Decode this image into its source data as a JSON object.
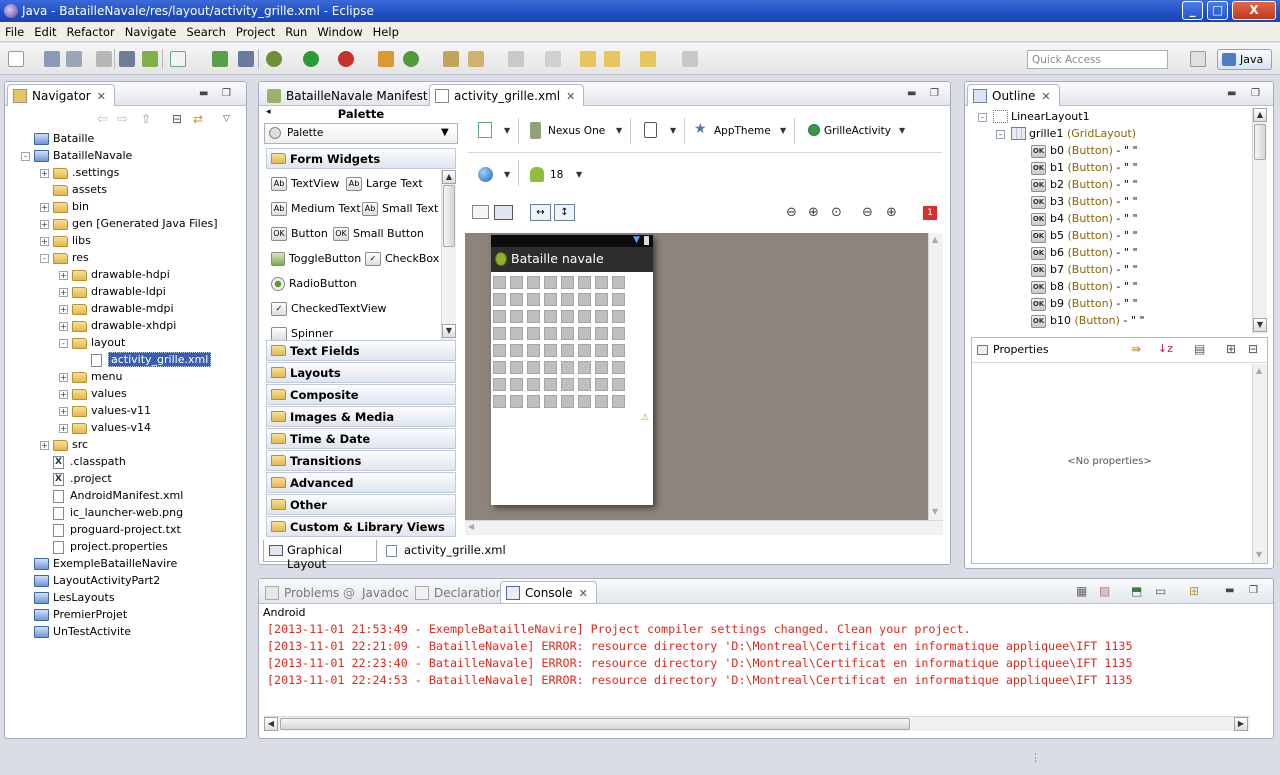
{
  "window": {
    "title": "Java - BatailleNavale/res/layout/activity_grille.xml - Eclipse",
    "min": "_",
    "max": "□",
    "close": "X"
  },
  "menu": [
    "File",
    "Edit",
    "Refactor",
    "Navigate",
    "Search",
    "Project",
    "Run",
    "Window",
    "Help"
  ],
  "toolbar": {
    "quick_access_placeholder": "Quick Access",
    "perspective": "Java"
  },
  "navigator": {
    "title": "Navigator",
    "items": [
      {
        "label": "Bataille",
        "depth": 0,
        "kind": "project",
        "exp": ""
      },
      {
        "label": "BatailleNavale",
        "depth": 0,
        "kind": "project",
        "exp": "-"
      },
      {
        "label": ".settings",
        "depth": 1,
        "kind": "folder",
        "exp": "+"
      },
      {
        "label": "assets",
        "depth": 1,
        "kind": "folder",
        "exp": ""
      },
      {
        "label": "bin",
        "depth": 1,
        "kind": "folder",
        "exp": "+"
      },
      {
        "label": "gen [Generated Java Files]",
        "depth": 1,
        "kind": "folder",
        "exp": "+"
      },
      {
        "label": "libs",
        "depth": 1,
        "kind": "folder",
        "exp": "+"
      },
      {
        "label": "res",
        "depth": 1,
        "kind": "folder",
        "exp": "-"
      },
      {
        "label": "drawable-hdpi",
        "depth": 2,
        "kind": "folder",
        "exp": "+"
      },
      {
        "label": "drawable-ldpi",
        "depth": 2,
        "kind": "folder",
        "exp": "+"
      },
      {
        "label": "drawable-mdpi",
        "depth": 2,
        "kind": "folder",
        "exp": "+"
      },
      {
        "label": "drawable-xhdpi",
        "depth": 2,
        "kind": "folder",
        "exp": "+"
      },
      {
        "label": "layout",
        "depth": 2,
        "kind": "folder",
        "exp": "-"
      },
      {
        "label": "activity_grille.xml",
        "depth": 3,
        "kind": "xml",
        "exp": "",
        "selected": true
      },
      {
        "label": "menu",
        "depth": 2,
        "kind": "folder",
        "exp": "+"
      },
      {
        "label": "values",
        "depth": 2,
        "kind": "folder",
        "exp": "+"
      },
      {
        "label": "values-v11",
        "depth": 2,
        "kind": "folder",
        "exp": "+"
      },
      {
        "label": "values-v14",
        "depth": 2,
        "kind": "folder",
        "exp": "+"
      },
      {
        "label": "src",
        "depth": 1,
        "kind": "folder",
        "exp": "+"
      },
      {
        "label": ".classpath",
        "depth": 1,
        "kind": "xfile",
        "exp": ""
      },
      {
        "label": ".project",
        "depth": 1,
        "kind": "xfile",
        "exp": ""
      },
      {
        "label": "AndroidManifest.xml",
        "depth": 1,
        "kind": "file",
        "exp": ""
      },
      {
        "label": "ic_launcher-web.png",
        "depth": 1,
        "kind": "file",
        "exp": ""
      },
      {
        "label": "proguard-project.txt",
        "depth": 1,
        "kind": "file",
        "exp": ""
      },
      {
        "label": "project.properties",
        "depth": 1,
        "kind": "file",
        "exp": ""
      },
      {
        "label": "ExempleBatailleNavire",
        "depth": 0,
        "kind": "project",
        "exp": ""
      },
      {
        "label": "LayoutActivityPart2",
        "depth": 0,
        "kind": "project",
        "exp": ""
      },
      {
        "label": "LesLayouts",
        "depth": 0,
        "kind": "project",
        "exp": ""
      },
      {
        "label": "PremierProjet",
        "depth": 0,
        "kind": "project",
        "exp": ""
      },
      {
        "label": "UnTestActivite",
        "depth": 0,
        "kind": "project",
        "exp": ""
      }
    ]
  },
  "editor": {
    "tabs": [
      "BatailleNavale Manifest",
      "activity_grille.xml"
    ],
    "palette": {
      "title": "Palette",
      "dropdown": "Palette",
      "open_category": "Form Widgets",
      "widgets": [
        {
          "label": "TextView",
          "icon": "Ab"
        },
        {
          "label": "Large Text",
          "icon": "Ab"
        },
        {
          "label": "Medium Text",
          "icon": "Ab"
        },
        {
          "label": "Small Text",
          "icon": "Ab"
        },
        {
          "label": "Button",
          "icon": "OK"
        },
        {
          "label": "Small Button",
          "icon": "OK"
        },
        {
          "label": "ToggleButton",
          "icon": ""
        },
        {
          "label": "CheckBox",
          "icon": "✓"
        },
        {
          "label": "RadioButton",
          "icon": ""
        },
        {
          "label": "CheckedTextView",
          "icon": "✓"
        },
        {
          "label": "Spinner",
          "icon": ""
        }
      ],
      "categories": [
        "Text Fields",
        "Layouts",
        "Composite",
        "Images & Media",
        "Time & Date",
        "Transitions",
        "Advanced",
        "Other",
        "Custom & Library Views"
      ]
    },
    "config": {
      "device": "Nexus One",
      "theme": "AppTheme",
      "activity": "GrilleActivity",
      "api": "18",
      "error_count": "1"
    },
    "preview": {
      "app_title": "Bataille navale",
      "warning": "⚠"
    },
    "bottom_tabs": [
      "Graphical Layout",
      "activity_grille.xml"
    ]
  },
  "outline": {
    "title": "Outline",
    "root": "LinearLayout1",
    "grid": "grille1",
    "grid_type": "(GridLayout)",
    "buttons": [
      {
        "id": "b0",
        "type": "(Button)",
        "text": "- \" \""
      },
      {
        "id": "b1",
        "type": "(Button)",
        "text": "- \" \""
      },
      {
        "id": "b2",
        "type": "(Button)",
        "text": "- \" \""
      },
      {
        "id": "b3",
        "type": "(Button)",
        "text": "- \" \""
      },
      {
        "id": "b4",
        "type": "(Button)",
        "text": "- \" \""
      },
      {
        "id": "b5",
        "type": "(Button)",
        "text": "- \" \""
      },
      {
        "id": "b6",
        "type": "(Button)",
        "text": "- \" \""
      },
      {
        "id": "b7",
        "type": "(Button)",
        "text": "- \" \""
      },
      {
        "id": "b8",
        "type": "(Button)",
        "text": "- \" \""
      },
      {
        "id": "b9",
        "type": "(Button)",
        "text": "- \" \""
      },
      {
        "id": "b10",
        "type": "(Button)",
        "text": "- \" \""
      }
    ]
  },
  "properties": {
    "title": "Properties",
    "empty": "<No properties>"
  },
  "console": {
    "tabs": [
      "Problems",
      "Javadoc",
      "Declaration",
      "Console"
    ],
    "label": "Android",
    "lines": [
      "[2013-11-01 21:53:49 - ExempleBatailleNavire] Project compiler settings changed. Clean your project.",
      "[2013-11-01 22:21:09 - BatailleNavale] ERROR: resource directory 'D:\\Montreal\\Certificat en informatique appliquee\\IFT 1135",
      "[2013-11-01 22:23:40 - BatailleNavale] ERROR: resource directory 'D:\\Montreal\\Certificat en informatique appliquee\\IFT 1135",
      "[2013-11-01 22:24:53 - BatailleNavale] ERROR: resource directory 'D:\\Montreal\\Certificat en informatique appliquee\\IFT 1135"
    ]
  }
}
